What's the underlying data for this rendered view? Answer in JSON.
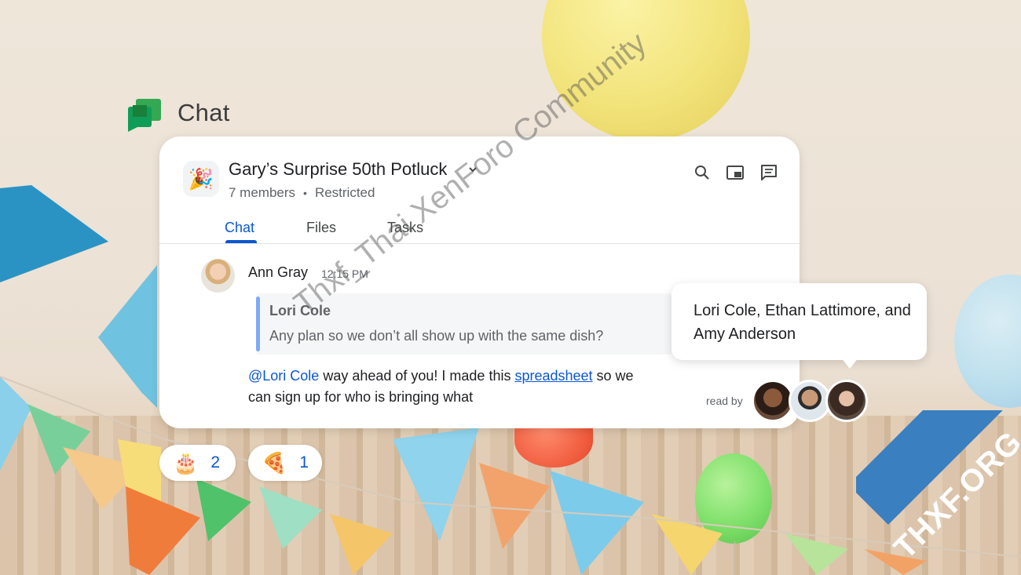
{
  "app": {
    "title": "Chat"
  },
  "room": {
    "emoji": "🎉",
    "name": "Gary’s Surprise 50th Potluck",
    "members": "7 members",
    "separator": "•",
    "access": "Restricted"
  },
  "tabs": [
    {
      "label": "Chat",
      "active": true
    },
    {
      "label": "Files",
      "active": false
    },
    {
      "label": "Tasks",
      "active": false
    }
  ],
  "message": {
    "sender": "Ann Gray",
    "time": "12:15 PM",
    "quote_author": "Lori Cole",
    "quote_text": "Any plan so we don’t all show up with the same dish?",
    "mention": "@Lori Cole",
    "text_before_link": " way ahead of you! I made this ",
    "link_text": "spreadsheet",
    "text_after_link": " so we can sign up for who is bringing what"
  },
  "read_by": {
    "label": "read by"
  },
  "tooltip": {
    "text": "Lori Cole, Ethan Lattimore, and Amy Anderson"
  },
  "reactions": [
    {
      "emoji": "🎂",
      "count": "2"
    },
    {
      "emoji": "🍕",
      "count": "1"
    }
  ],
  "watermarks": {
    "diagonal": "Thxf_Thai XenForo Community",
    "corner": "THXF.ORG"
  },
  "colors": {
    "accent": "#0b57d0",
    "chat_green": "#34a853",
    "quote_bar": "#7faaf5"
  },
  "icons": [
    "chat-logo-icon",
    "chevron-down-icon",
    "search-icon",
    "pip-icon",
    "thread-icon"
  ]
}
